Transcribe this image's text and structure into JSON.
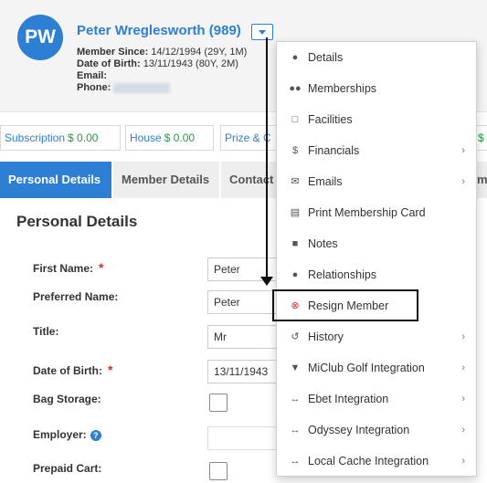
{
  "member": {
    "initials": "PW",
    "name": "Peter Wreglesworth (989)",
    "member_since_label": "Member Since:",
    "member_since": "14/12/1994 (29Y, 1M)",
    "dob_label": "Date of Birth:",
    "dob": "13/11/1943 (80Y, 2M)",
    "email_label": "Email:",
    "phone_label": "Phone:"
  },
  "summary": [
    {
      "label": "Subscription",
      "amount": "$ 0.00"
    },
    {
      "label": "House",
      "amount": "$ 0.00"
    },
    {
      "label": "Prize & C",
      "amount": ""
    },
    {
      "label": "",
      "amount": "$"
    }
  ],
  "tabs": [
    "Personal Details",
    "Member Details",
    "Contact",
    "m"
  ],
  "section_title": "Personal Details",
  "fields": {
    "first_name_label": "First Name:",
    "first_name_value": "Peter",
    "preferred_name_label": "Preferred Name:",
    "preferred_name_value": "Peter",
    "title_label": "Title:",
    "title_value": "Mr",
    "dob_label": "Date of Birth:",
    "dob_value": "13/11/1943",
    "bag_storage_label": "Bag Storage:",
    "employer_label": "Employer:",
    "prepaid_cart_label": "Prepaid Cart:",
    "required_mark": "*",
    "help_glyph": "?"
  },
  "menu": [
    {
      "label": "Details",
      "icon": "user-icon",
      "submenu": false
    },
    {
      "label": "Memberships",
      "icon": "users-icon",
      "submenu": false
    },
    {
      "label": "Facilities",
      "icon": "sitemap-icon",
      "submenu": false
    },
    {
      "label": "Financials",
      "icon": "dollar-icon",
      "submenu": true
    },
    {
      "label": "Emails",
      "icon": "envelope-icon",
      "submenu": true
    },
    {
      "label": "Print Membership Card",
      "icon": "print-icon",
      "submenu": false
    },
    {
      "label": "Notes",
      "icon": "archive-icon",
      "submenu": false
    },
    {
      "label": "Relationships",
      "icon": "user-icon",
      "submenu": false
    },
    {
      "label": "Resign Member",
      "icon": "times-circle-icon",
      "submenu": false
    },
    {
      "label": "History",
      "icon": "history-icon",
      "submenu": true
    },
    {
      "label": "MiClub Golf Integration",
      "icon": "trophy-icon",
      "submenu": true
    },
    {
      "label": "Ebet Integration",
      "icon": "exchange-icon",
      "submenu": true
    },
    {
      "label": "Odyssey Integration",
      "icon": "exchange-icon",
      "submenu": true
    },
    {
      "label": "Local Cache Integration",
      "icon": "exchange-icon",
      "submenu": true
    }
  ],
  "colors": {
    "accent": "#2d7fd3",
    "amount_green": "#1e9e3a",
    "required_red": "#d9302c"
  }
}
